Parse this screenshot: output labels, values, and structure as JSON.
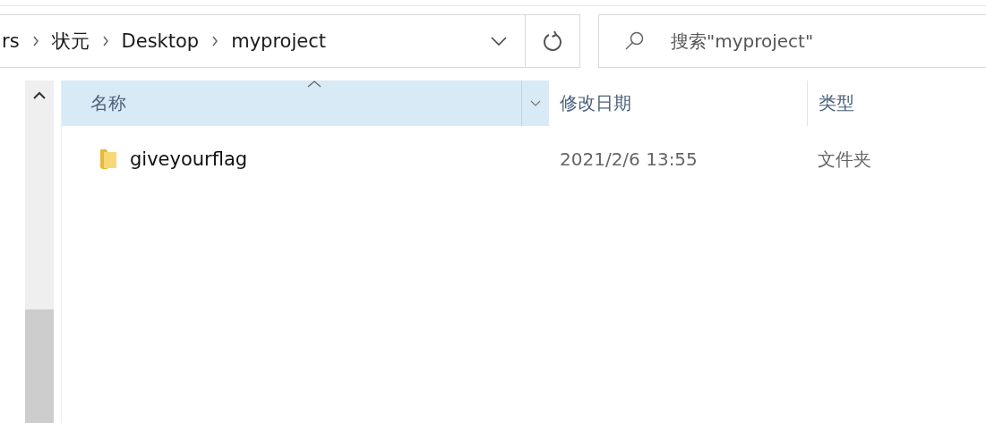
{
  "address_bar": {
    "segments": [
      "rs",
      "状元",
      "Desktop",
      "myproject"
    ]
  },
  "search": {
    "placeholder": "搜索\"myproject\""
  },
  "table": {
    "columns": [
      {
        "label": "名称",
        "sorted": true
      },
      {
        "label": "修改日期",
        "sorted": false
      },
      {
        "label": "类型",
        "sorted": false
      }
    ],
    "rows": [
      {
        "kind": "folder",
        "cells": [
          "giveyourflag",
          "2021/2/6 13:55",
          "文件夹"
        ]
      }
    ]
  }
}
